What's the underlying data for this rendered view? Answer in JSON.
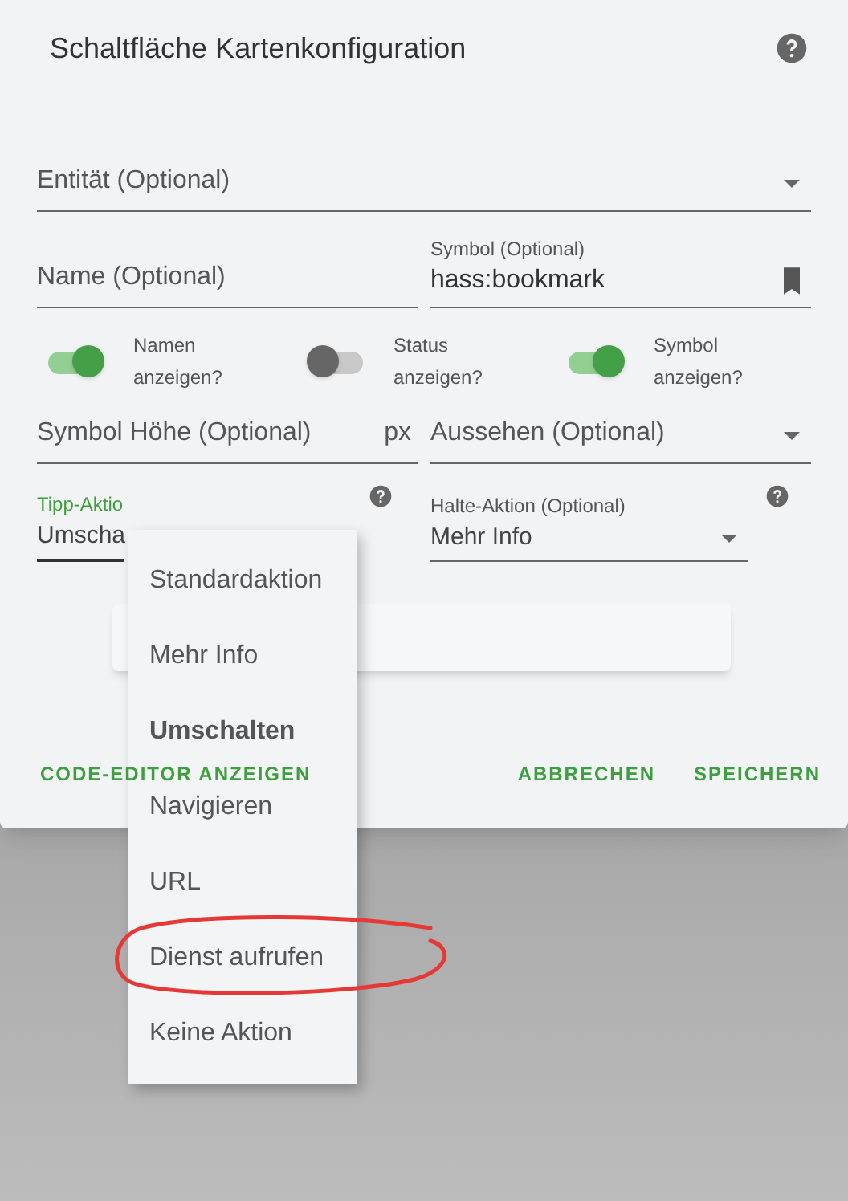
{
  "title": "Schaltfläche Kartenkonfiguration",
  "entity_field": {
    "placeholder": "Entität (Optional)"
  },
  "name_field": {
    "placeholder": "Name (Optional)"
  },
  "icon_field": {
    "label": "Symbol (Optional)",
    "value": "hass:bookmark"
  },
  "toggles": [
    {
      "label": "Namen anzeigen?",
      "on": true
    },
    {
      "label": "Status anzeigen?",
      "on": false
    },
    {
      "label": "Symbol anzeigen?",
      "on": true
    }
  ],
  "icon_height_field": {
    "placeholder": "Symbol Höhe (Optional)",
    "suffix": "px"
  },
  "appearance_field": {
    "placeholder": "Aussehen (Optional)"
  },
  "tap_action_field": {
    "label": "Tipp-Aktio",
    "value": "Umscha",
    "focused": true
  },
  "hold_action_field": {
    "label": "Halte-Aktion (Optional)",
    "value": "Mehr Info",
    "focused": false
  },
  "buttons": [
    "CODE-EDITOR ANZEIGEN",
    "ABBRECHEN",
    "SPEICHERN"
  ],
  "menu": {
    "items": [
      {
        "label": "Standardaktion",
        "selected": false
      },
      {
        "label": "Mehr Info",
        "selected": false
      },
      {
        "label": "Umschalten",
        "selected": true
      },
      {
        "label": "Navigieren",
        "selected": false
      },
      {
        "label": "URL",
        "selected": false
      },
      {
        "label": "Dienst aufrufen",
        "selected": false
      },
      {
        "label": "Keine Aktion",
        "selected": false
      }
    ]
  }
}
